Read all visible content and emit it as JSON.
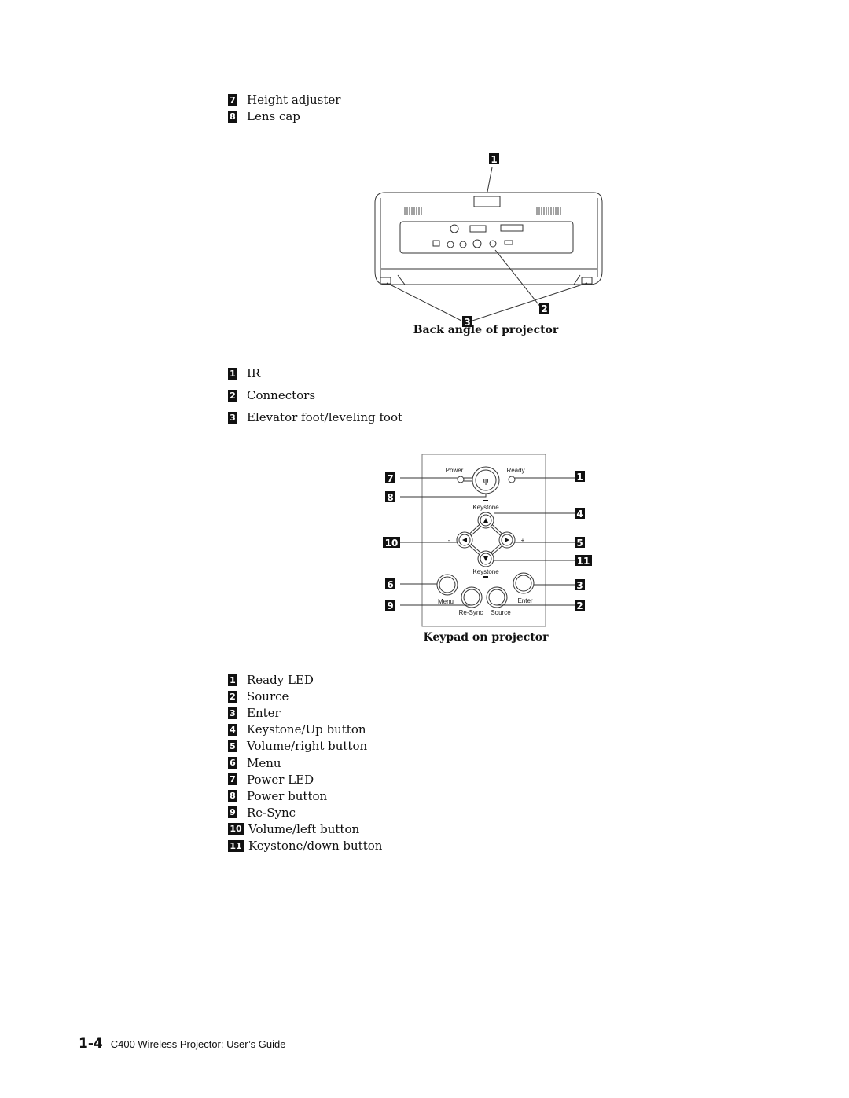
{
  "top_list": [
    {
      "num": "7",
      "label": "Height adjuster"
    },
    {
      "num": "8",
      "label": "Lens cap"
    }
  ],
  "back_figure": {
    "caption": "Back angle of projector",
    "callouts": [
      "1",
      "2",
      "3"
    ],
    "items": [
      {
        "num": "1",
        "label": "IR"
      },
      {
        "num": "2",
        "label": "Connectors"
      },
      {
        "num": "3",
        "label": "Elevator foot/leveling foot"
      }
    ]
  },
  "keypad_figure": {
    "caption": "Keypad on projector",
    "panel_labels": {
      "power": "Power",
      "ready": "Ready",
      "keystone_up": "Keystone",
      "keystone_down": "Keystone",
      "menu": "Menu",
      "enter": "Enter",
      "resync": "Re-Sync",
      "source": "Source",
      "vol_minus": "-",
      "vol_plus": "+"
    },
    "callouts_left": [
      "7",
      "8",
      "10",
      "6",
      "9"
    ],
    "callouts_right": [
      "1",
      "4",
      "5",
      "11",
      "3",
      "2"
    ],
    "items": [
      {
        "num": "1",
        "label": "Ready LED"
      },
      {
        "num": "2",
        "label": "Source"
      },
      {
        "num": "3",
        "label": "Enter"
      },
      {
        "num": "4",
        "label": "Keystone/Up button"
      },
      {
        "num": "5",
        "label": "Volume/right button"
      },
      {
        "num": "6",
        "label": "Menu"
      },
      {
        "num": "7",
        "label": "Power LED"
      },
      {
        "num": "8",
        "label": "Power button"
      },
      {
        "num": "9",
        "label": "Re-Sync"
      },
      {
        "num": "10",
        "label": "Volume/left button"
      },
      {
        "num": "11",
        "label": "Keystone/down button"
      }
    ]
  },
  "footer": {
    "page": "1-4",
    "title": "C400 Wireless Projector: User’s Guide"
  }
}
